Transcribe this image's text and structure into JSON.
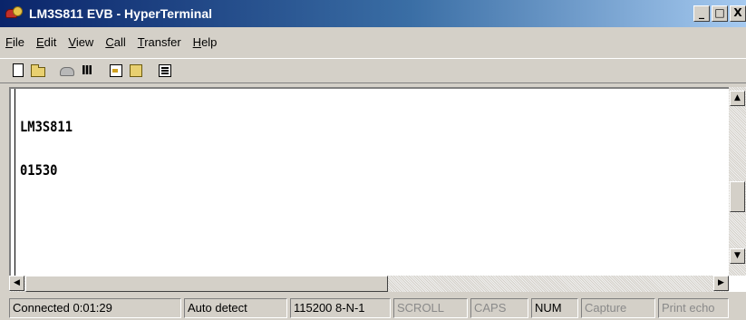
{
  "window": {
    "title": "LM3S811 EVB - HyperTerminal",
    "controls": {
      "minimize": "_",
      "maximize": "□",
      "close": "X"
    }
  },
  "menu": [
    {
      "label": "File",
      "key": "F",
      "rest": "ile"
    },
    {
      "label": "Edit",
      "key": "E",
      "rest": "dit"
    },
    {
      "label": "View",
      "key": "V",
      "rest": "iew"
    },
    {
      "label": "Call",
      "key": "C",
      "rest": "all"
    },
    {
      "label": "Transfer",
      "key": "T",
      "rest": "ransfer"
    },
    {
      "label": "Help",
      "key": "H",
      "rest": "elp"
    }
  ],
  "toolbar": {
    "icons": [
      "new-connection-icon",
      "open-icon",
      "call-icon",
      "disconnect-icon",
      "send-icon",
      "receive-icon",
      "properties-icon"
    ]
  },
  "terminal": {
    "lines": [
      "LM3S811",
      "01530"
    ]
  },
  "statusbar": {
    "connected": "Connected 0:01:29",
    "detect": "Auto detect",
    "settings": "115200 8-N-1",
    "scroll": "SCROLL",
    "caps": "CAPS",
    "num": "NUM",
    "capture": "Capture",
    "print_echo": "Print echo"
  },
  "colors": {
    "titlebar_start": "#0a246a",
    "titlebar_end": "#a6caf0",
    "chrome": "#d4d0c8"
  }
}
